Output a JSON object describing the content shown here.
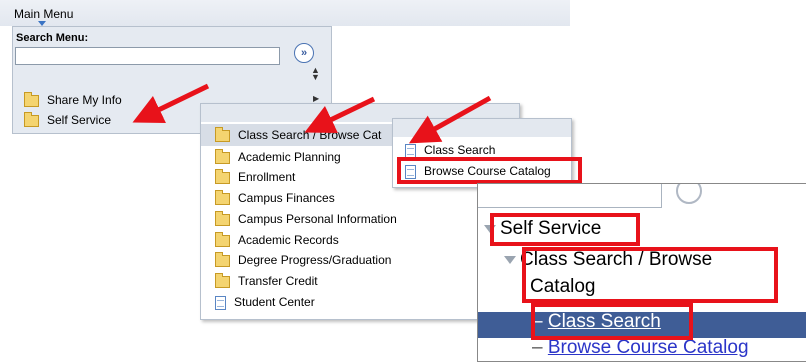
{
  "main_menu": {
    "title": "Main Menu"
  },
  "search": {
    "label": "Search Menu:",
    "value": "",
    "go_symbol": "»"
  },
  "menu1": {
    "items": [
      {
        "label": "Share My Info",
        "icon": "folder-icon",
        "submenu": true
      },
      {
        "label": "Self Service",
        "icon": "folder-icon",
        "submenu": true
      }
    ]
  },
  "menu2": {
    "items": [
      {
        "label": "Class Search / Browse Cat",
        "icon": "folder-icon"
      },
      {
        "label": "Academic Planning",
        "icon": "folder-icon"
      },
      {
        "label": "Enrollment",
        "icon": "folder-icon"
      },
      {
        "label": "Campus Finances",
        "icon": "folder-icon"
      },
      {
        "label": "Campus Personal Information",
        "icon": "folder-icon"
      },
      {
        "label": "Academic Records",
        "icon": "folder-icon"
      },
      {
        "label": "Degree Progress/Graduation",
        "icon": "folder-icon"
      },
      {
        "label": "Transfer Credit",
        "icon": "folder-icon"
      },
      {
        "label": "Student Center",
        "icon": "document-icon"
      }
    ]
  },
  "menu3": {
    "items": [
      {
        "label": "Class Search",
        "icon": "document-icon"
      },
      {
        "label": "Browse Course Catalog",
        "icon": "document-icon"
      }
    ]
  },
  "zoom": {
    "self_service": "Self Service",
    "class_search_browse_line1": "Class Search / Browse",
    "class_search_browse_line2": "Catalog",
    "class_search": "Class Search",
    "browse_course_catalog": "Browse Course Catalog",
    "dash": "–"
  },
  "colors": {
    "annotation_red": "#e8121a",
    "selected_blue": "#3f5d96",
    "link_blue": "#2b35c8"
  }
}
